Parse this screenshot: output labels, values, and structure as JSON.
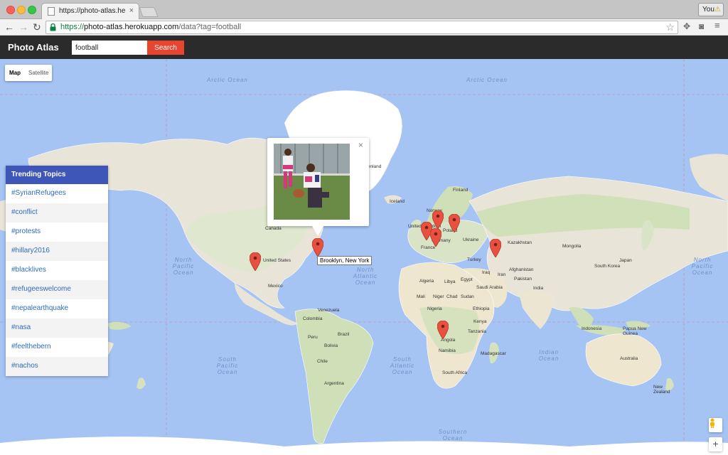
{
  "browser": {
    "tab_title": "https://photo-atlas.herokuapp",
    "tab_close": "×",
    "profile_name": "You",
    "url_scheme": "https://",
    "url_host": "photo-atlas.herokuapp.com",
    "url_path": "/data?tag=football"
  },
  "app": {
    "brand": "Photo Atlas",
    "search_value": "football",
    "search_button": "Search"
  },
  "map": {
    "type_controls": [
      "Map",
      "Satellite"
    ],
    "active_type": "Map",
    "oceans": [
      {
        "label": "Arctic Ocean"
      },
      {
        "label": "Arctic Ocean"
      },
      {
        "label": "North Pacific Ocean"
      },
      {
        "label": "North Atlantic Ocean"
      },
      {
        "label": "North Pacific Ocean"
      },
      {
        "label": "South Pacific Ocean"
      },
      {
        "label": "South Atlantic Ocean"
      },
      {
        "label": "Indian Ocean"
      },
      {
        "label": "Southern Ocean"
      }
    ],
    "places": [
      "Canada",
      "United States",
      "Mexico",
      "Venezuela",
      "Colombia",
      "Peru",
      "Brazil",
      "Bolivia",
      "Chile",
      "Argentina",
      "Iceland",
      "Finland",
      "Norway",
      "Poland",
      "Ukraine",
      "Kazakhstan",
      "Mongolia",
      "South Korea",
      "Turkey",
      "Iraq",
      "Iran",
      "Afghanistan",
      "Pakistan",
      "India",
      "Saudi Arabia",
      "Egypt",
      "Algeria",
      "Libya",
      "Mali",
      "Niger",
      "Chad",
      "Sudan",
      "Nigeria",
      "Ethiopia",
      "Kenya",
      "Tanzania",
      "Angola",
      "Namibia",
      "Madagascar",
      "South Africa",
      "Indonesia",
      "Papua New Guinea",
      "Australia",
      "New Zealand",
      "France",
      "United Kingdom",
      "Germany",
      "Greenland",
      "Japan"
    ],
    "popup_close": "×",
    "tooltip": "Brooklyn, New York",
    "zoom_in": "+"
  },
  "trending": {
    "title": "Trending Topics",
    "topics": [
      "#SyrianRefugees",
      "#conflict",
      "#protests",
      "#hillary2016",
      "#blacklives",
      "#refugeeswelcome",
      "#nepalearthquake",
      "#nasa",
      "#feelthebern",
      "#nachos"
    ]
  },
  "colors": {
    "ocean": "#a5c3f3",
    "land": "#e8e4d8",
    "forest": "#c9dcb0",
    "ice": "#ffffff",
    "appbar": "#2b2b2b",
    "search_button": "#e8442f",
    "trending_header": "#3d56b8",
    "topic_link": "#2d6cc0",
    "pin": "#e8503f"
  }
}
